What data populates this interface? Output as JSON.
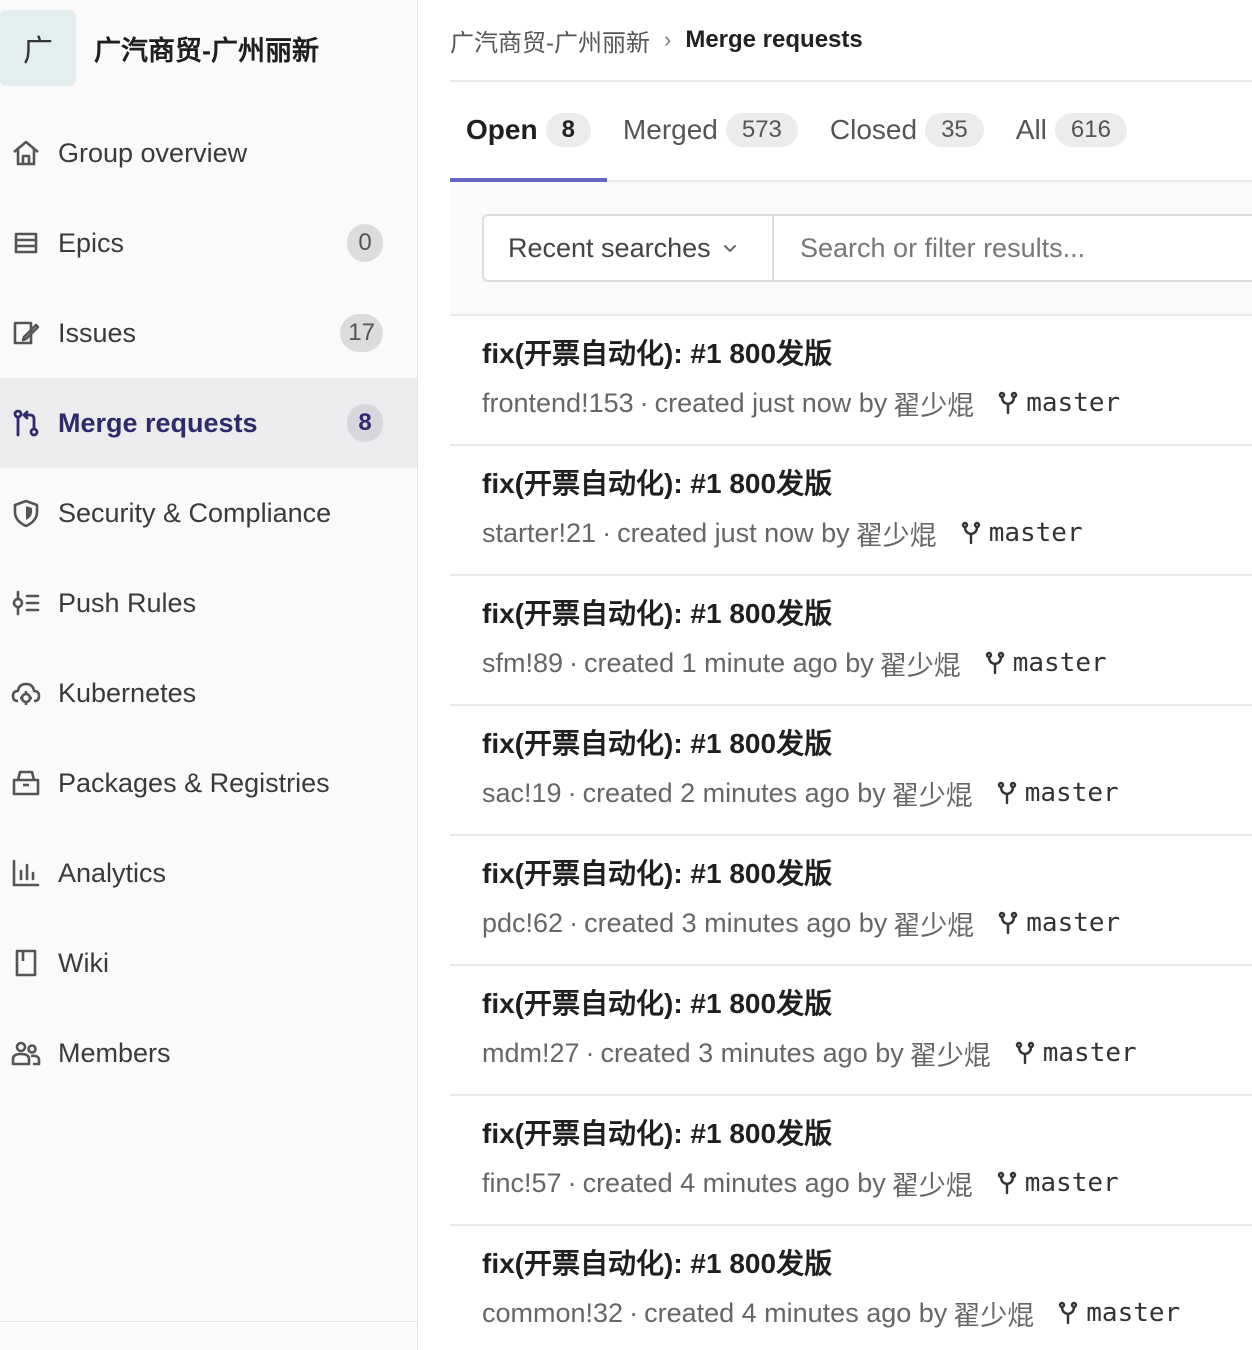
{
  "group": {
    "avatar_letter": "广",
    "name": "广汽商贸-广州丽新"
  },
  "nav": [
    {
      "label": "Group overview",
      "icon": "home-icon"
    },
    {
      "label": "Epics",
      "icon": "epic-icon",
      "count": "0"
    },
    {
      "label": "Issues",
      "icon": "issues-icon",
      "count": "17"
    },
    {
      "label": "Merge requests",
      "icon": "merge-request-icon",
      "count": "8",
      "active": true
    },
    {
      "label": "Security & Compliance",
      "icon": "shield-icon"
    },
    {
      "label": "Push Rules",
      "icon": "push-rules-icon"
    },
    {
      "label": "Kubernetes",
      "icon": "kubernetes-cloud-icon"
    },
    {
      "label": "Packages & Registries",
      "icon": "package-icon"
    },
    {
      "label": "Analytics",
      "icon": "analytics-chart-icon"
    },
    {
      "label": "Wiki",
      "icon": "book-icon"
    },
    {
      "label": "Members",
      "icon": "users-icon"
    }
  ],
  "breadcrumb": {
    "parent": "广汽商贸-广州丽新",
    "current": "Merge requests"
  },
  "tabs": [
    {
      "label": "Open",
      "count": "8",
      "active": true
    },
    {
      "label": "Merged",
      "count": "573"
    },
    {
      "label": "Closed",
      "count": "35"
    },
    {
      "label": "All",
      "count": "616"
    }
  ],
  "filter": {
    "recent_label": "Recent searches",
    "placeholder": "Search or filter results..."
  },
  "merge_requests": [
    {
      "title": "fix(开票自动化): #1 800发版",
      "ref": "frontend!153",
      "created": "created just now by",
      "author": "翟少焜",
      "branch": "master"
    },
    {
      "title": "fix(开票自动化): #1 800发版",
      "ref": "starter!21",
      "created": "created just now by",
      "author": "翟少焜",
      "branch": "master"
    },
    {
      "title": "fix(开票自动化): #1 800发版",
      "ref": "sfm!89",
      "created": "created 1 minute ago by",
      "author": "翟少焜",
      "branch": "master"
    },
    {
      "title": "fix(开票自动化): #1 800发版",
      "ref": "sac!19",
      "created": "created 2 minutes ago by",
      "author": "翟少焜",
      "branch": "master"
    },
    {
      "title": "fix(开票自动化): #1 800发版",
      "ref": "pdc!62",
      "created": "created 3 minutes ago by",
      "author": "翟少焜",
      "branch": "master"
    },
    {
      "title": "fix(开票自动化): #1 800发版",
      "ref": "mdm!27",
      "created": "created 3 minutes ago by",
      "author": "翟少焜",
      "branch": "master"
    },
    {
      "title": "fix(开票自动化): #1 800发版",
      "ref": "finc!57",
      "created": "created 4 minutes ago by",
      "author": "翟少焜",
      "branch": "master"
    },
    {
      "title": "fix(开票自动化): #1 800发版",
      "ref": "common!32",
      "created": "created 4 minutes ago by",
      "author": "翟少焜",
      "branch": "master"
    }
  ],
  "colors": {
    "active_tab_underline": "#6666c4",
    "active_nav_text": "#2f2a6b",
    "sidebar_bg": "#fafafa"
  }
}
